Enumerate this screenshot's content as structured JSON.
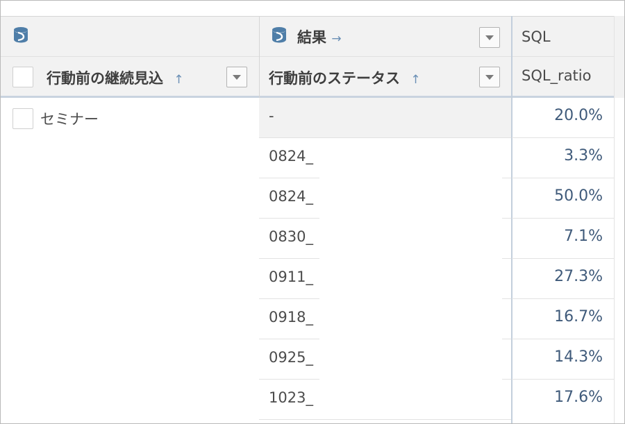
{
  "header": {
    "col1_group_label": "",
    "col2_group_label": "結果",
    "col3_group_label": "SQL",
    "col1_title": "行動前の継続見込",
    "col2_title": "行動前のステータス",
    "col3_title": "SQL_ratio",
    "sort_up": "↑",
    "group_arrow": "→"
  },
  "group": {
    "label": "セミナー"
  },
  "rows": [
    {
      "status": "-",
      "sql_ratio": "20.0%"
    },
    {
      "status": "0824_",
      "sql_ratio": "3.3%"
    },
    {
      "status": "0824_",
      "sql_ratio": "50.0%"
    },
    {
      "status": "0830_",
      "sql_ratio": "7.1%"
    },
    {
      "status": "0911_",
      "sql_ratio": "27.3%"
    },
    {
      "status": "0918_",
      "sql_ratio": "16.7%"
    },
    {
      "status": "0925_",
      "sql_ratio": "14.3%"
    },
    {
      "status": "1023_",
      "sql_ratio": "17.6%"
    }
  ],
  "colors": {
    "header_bg": "#f2f2f2",
    "value_text": "#3f5a7a",
    "accent_line": "#c9d3df"
  }
}
